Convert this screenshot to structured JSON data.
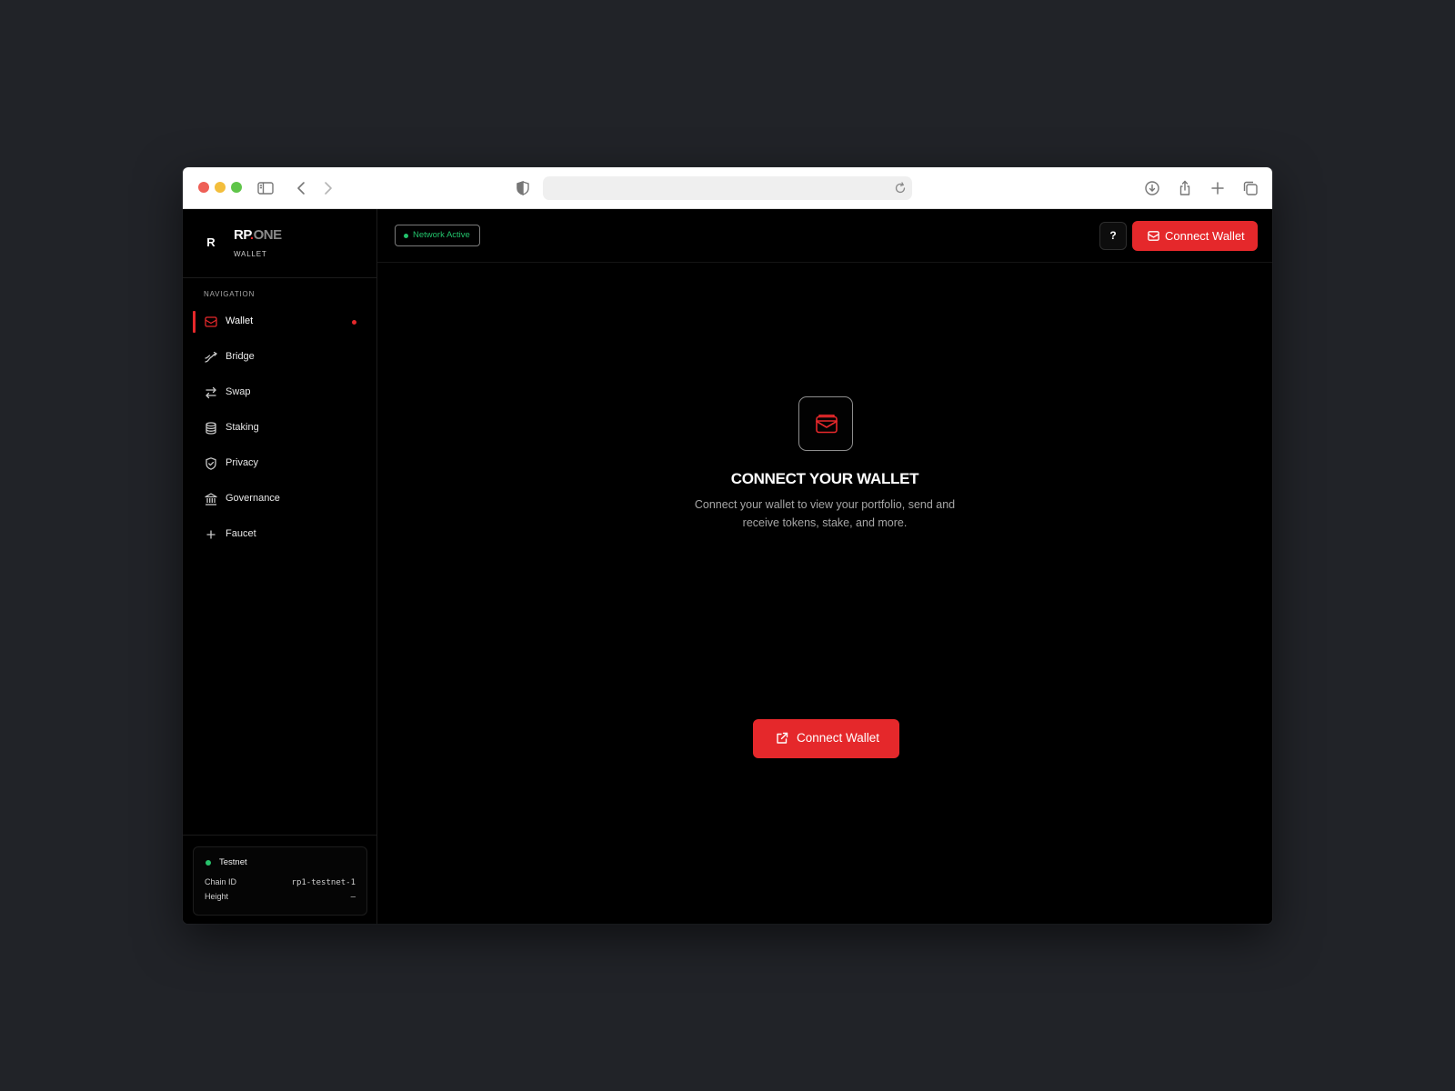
{
  "brand": {
    "mark": "R",
    "name_rp": "RP",
    "name_dot": ".",
    "name_one": "ONE",
    "subtitle": "WALLET"
  },
  "sidebar": {
    "section_label": "NAVIGATION",
    "items": [
      {
        "label": "Wallet",
        "icon": "wallet-icon",
        "active": true
      },
      {
        "label": "Bridge",
        "icon": "bridge-icon"
      },
      {
        "label": "Swap",
        "icon": "swap-icon"
      },
      {
        "label": "Staking",
        "icon": "database-icon"
      },
      {
        "label": "Privacy",
        "icon": "shield-check-icon"
      },
      {
        "label": "Governance",
        "icon": "bank-icon"
      },
      {
        "label": "Faucet",
        "icon": "plus-icon"
      }
    ],
    "network": {
      "name": "Testnet",
      "chain_id_label": "Chain ID",
      "chain_id_value": "rp1-testnet-1",
      "height_label": "Height",
      "height_value": "–"
    }
  },
  "topbar": {
    "network_badge": "Network Active",
    "help_label": "?",
    "connect_label": "Connect Wallet"
  },
  "hero": {
    "title": "CONNECT YOUR WALLET",
    "description": "Connect your wallet to view your portfolio, send and receive tokens, stake, and more.",
    "button_label": "Connect Wallet"
  },
  "colors": {
    "accent": "#e5282b",
    "success": "#22c26b",
    "background": "#000000",
    "desktop": "#212328"
  }
}
